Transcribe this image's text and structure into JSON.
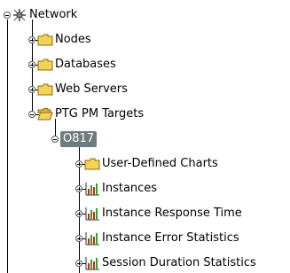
{
  "tree": {
    "nodes": [
      {
        "name": "node-network",
        "label": "Network",
        "icon": "network-icon",
        "level": 0,
        "expanded": true
      },
      {
        "name": "node-nodes",
        "label": "Nodes",
        "icon": "folder-icon",
        "level": 1,
        "expanded": false
      },
      {
        "name": "node-databases",
        "label": "Databases",
        "icon": "folder-icon",
        "level": 1,
        "expanded": false
      },
      {
        "name": "node-web-servers",
        "label": "Web Servers",
        "icon": "folder-icon",
        "level": 1,
        "expanded": false
      },
      {
        "name": "node-ptg-pm-targets",
        "label": "PTG PM Targets",
        "icon": "folder-open-icon",
        "level": 1,
        "expanded": true
      },
      {
        "name": "node-o817",
        "label": "O817",
        "icon": "",
        "level": 2,
        "expanded": true,
        "selected": true
      },
      {
        "name": "node-user-defined-charts",
        "label": "User-Defined Charts",
        "icon": "folder-icon",
        "level": 3,
        "expanded": false
      },
      {
        "name": "node-instances",
        "label": "Instances",
        "icon": "chart-icon",
        "level": 3,
        "expanded": false
      },
      {
        "name": "node-instance-response-time",
        "label": "Instance Response Time",
        "icon": "chart-icon",
        "level": 3,
        "expanded": false
      },
      {
        "name": "node-instance-error-statistics",
        "label": "Instance Error Statistics",
        "icon": "chart-icon",
        "level": 3,
        "expanded": false
      },
      {
        "name": "node-session-duration-statistics",
        "label": "Session Duration Statistics",
        "icon": "chart-icon",
        "level": 3,
        "expanded": false
      }
    ]
  },
  "colors": {
    "folder_fill": "#f2d25a",
    "folder_edge": "#8a6d00",
    "selected_bg": "#6f7c7f",
    "chart_red": "#cc2222",
    "chart_green": "#22aa22"
  }
}
